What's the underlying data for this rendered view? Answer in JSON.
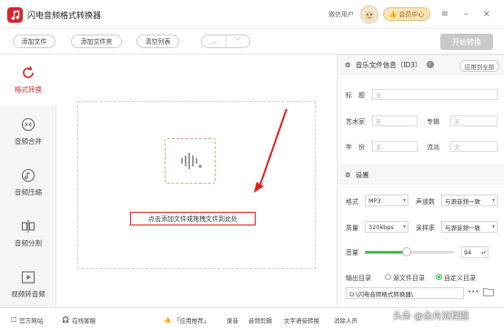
{
  "app": {
    "title": "闪电音频格式转换器",
    "user_name": "微信用户",
    "vip_label": "会员中心",
    "accent_color": "#d7262e"
  },
  "toolbar": {
    "add_file": "添加文件",
    "add_folder": "添加文件夹",
    "clear_list": "清空列表",
    "start_convert": "开始转换"
  },
  "sidebar": {
    "items": [
      {
        "label": "格式转换",
        "icon": "refresh-icon",
        "active": true
      },
      {
        "label": "音频合并",
        "icon": "merge-icon",
        "active": false
      },
      {
        "label": "音频压缩",
        "icon": "compress-icon",
        "active": false
      },
      {
        "label": "音频分割",
        "icon": "split-icon",
        "active": false
      },
      {
        "label": "视频转音频",
        "icon": "video-play-icon",
        "active": false
      }
    ]
  },
  "main": {
    "drop_text": "点击添加文件或拖拽文件到此处"
  },
  "id3": {
    "section_title": "音乐文件信息（ID3）",
    "apply_all": "应用到全部",
    "title_label": "标　题",
    "artist_label": "艺术家",
    "album_label": "专辑",
    "year_label": "年　份",
    "genre_label": "流派",
    "placeholder": "无"
  },
  "settings": {
    "section_title": "设置",
    "format_label": "格式",
    "format_value": "MP3",
    "channels_label": "声道数",
    "channels_value": "与源音频一致",
    "quality_label": "质量",
    "quality_value": "320kbps",
    "samplerate_label": "采样率",
    "samplerate_value": "与源音频一致",
    "volume_label": "音量",
    "volume_value": "94",
    "volume_fraction": 0.47,
    "output_label": "输出目录",
    "radio_source": "源文件目录",
    "radio_custom": "自定义目录",
    "output_path": "D:\\闪电音频格式转换器\\"
  },
  "footer": {
    "website": "官方网站",
    "support": "在线客服",
    "recommend": "「应用推荐」",
    "items": [
      "录音",
      "音频剪辑",
      "文字语音转换",
      "消除人声"
    ]
  },
  "watermark": "头条 @金舟流程图"
}
